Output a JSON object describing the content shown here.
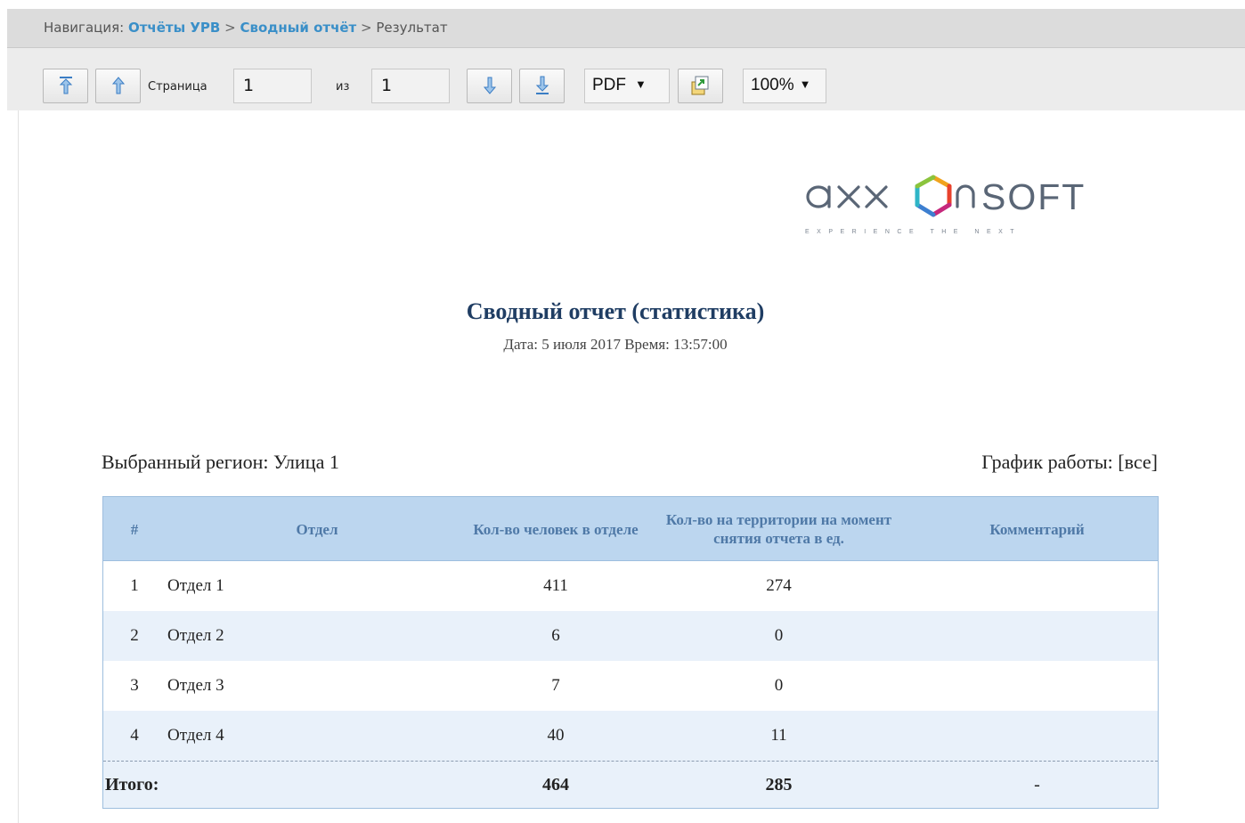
{
  "breadcrumb": {
    "prefix": "Навигация:",
    "items": [
      {
        "label": "Отчёты УРВ",
        "link": true
      },
      {
        "label": "Сводный отчёт",
        "link": true
      },
      {
        "label": "Результат",
        "link": false
      }
    ],
    "separator": ">"
  },
  "toolbar": {
    "page_label": "Страница",
    "page_value": "1",
    "of_label": "из",
    "total_pages": "1",
    "format_value": "PDF",
    "zoom_value": "100%",
    "dropdown_arrow": "▼"
  },
  "report": {
    "logo_text": "axxonsoft",
    "logo_tagline": "EXPERIENCE THE NEXT",
    "title": "Сводный отчет (статистика)",
    "date_line": "Дата: 5 июля 2017 Время: 13:57:00",
    "region": "Выбранный регион: Улица 1",
    "schedule": "График работы: [все]"
  },
  "table": {
    "headers": {
      "num": "#",
      "dept": "Отдел",
      "count": "Кол-во человек в отделе",
      "present": "Кол-во на территории на момент снятия отчета в ед.",
      "comment": "Комментарий"
    },
    "rows": [
      {
        "num": "1",
        "dept": "Отдел 1",
        "count": "411",
        "present": "274",
        "comment": ""
      },
      {
        "num": "2",
        "dept": "Отдел 2",
        "count": "6",
        "present": "0",
        "comment": ""
      },
      {
        "num": "3",
        "dept": "Отдел 3",
        "count": "7",
        "present": "0",
        "comment": ""
      },
      {
        "num": "4",
        "dept": "Отдел 4",
        "count": "40",
        "present": "11",
        "comment": ""
      }
    ],
    "total": {
      "label": "Итого:",
      "count": "464",
      "present": "285",
      "comment": "-"
    }
  },
  "colors": {
    "link": "#3a8fc8",
    "title": "#1f3d63",
    "header_bg": "#bcd6ef",
    "header_text": "#4f79a7",
    "alt_row": "#e9f1fa"
  }
}
